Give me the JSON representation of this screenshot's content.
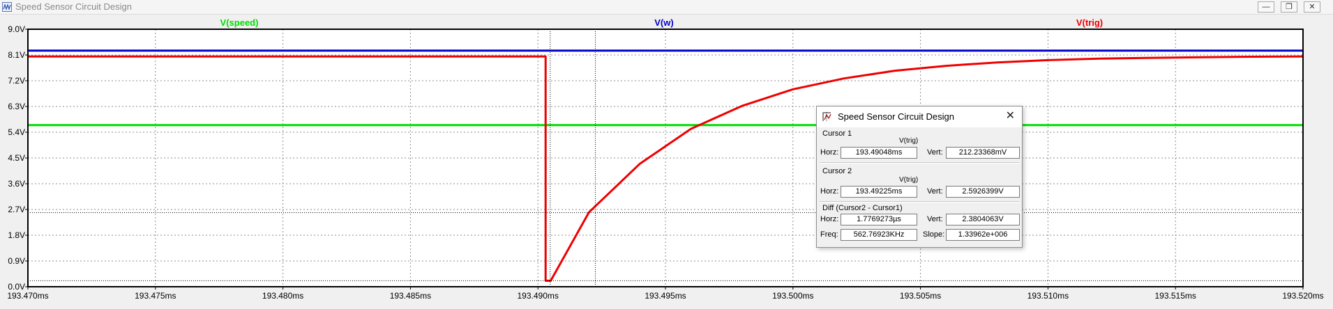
{
  "window": {
    "title": "Speed Sensor Circuit Design",
    "minimize_label": "—",
    "restore_label": "❐",
    "close_label": "✕"
  },
  "colors": {
    "speed": "#00dd00",
    "w": "#0000c8",
    "trig": "#ee0000",
    "grid": "#8c8c8c",
    "axis": "#000000"
  },
  "chart_data": {
    "type": "line",
    "x_unit": "ms",
    "xlim": [
      193.47,
      193.52
    ],
    "ylim": [
      0,
      9.0
    ],
    "x_ticks": [
      193.47,
      193.475,
      193.48,
      193.485,
      193.49,
      193.495,
      193.5,
      193.505,
      193.51,
      193.515,
      193.52
    ],
    "x_tick_labels": [
      "193.470ms",
      "193.475ms",
      "193.480ms",
      "193.485ms",
      "193.490ms",
      "193.495ms",
      "193.500ms",
      "193.505ms",
      "193.510ms",
      "193.515ms",
      "193.520ms"
    ],
    "y_ticks": [
      0,
      0.9,
      1.8,
      2.7,
      3.6,
      4.5,
      5.4,
      6.3,
      7.2,
      8.1,
      9.0
    ],
    "y_tick_labels": [
      "0.0V",
      "0.9V",
      "1.8V",
      "2.7V",
      "3.6V",
      "4.5V",
      "5.4V",
      "6.3V",
      "7.2V",
      "8.1V",
      "9.0V"
    ],
    "grid": true,
    "series": [
      {
        "name": "V(speed)",
        "x": [
          193.47,
          193.52
        ],
        "y": [
          5.65,
          5.65
        ]
      },
      {
        "name": "V(w)",
        "x": [
          193.47,
          193.52
        ],
        "y": [
          8.25,
          8.25
        ]
      },
      {
        "name": "V(trig)",
        "x": [
          193.47,
          193.4903,
          193.4903,
          193.4905,
          193.492,
          193.494,
          193.496,
          193.498,
          193.5,
          193.502,
          193.504,
          193.506,
          193.508,
          193.51,
          193.512,
          193.514,
          193.516,
          193.518,
          193.52
        ],
        "y": [
          8.05,
          8.05,
          0.21,
          0.21,
          2.6,
          4.3,
          5.52,
          6.32,
          6.9,
          7.28,
          7.55,
          7.72,
          7.84,
          7.92,
          7.97,
          8.0,
          8.02,
          8.04,
          8.05
        ]
      }
    ],
    "cursor_lines": {
      "x": [
        193.49048,
        193.49225
      ],
      "y": [
        0.21,
        2.59
      ]
    }
  },
  "cursor_dialog": {
    "title": "Speed Sensor Circuit Design",
    "close_label": "✕",
    "cursor1": {
      "label": "Cursor 1",
      "trace": "V(trig)",
      "horz_label": "Horz:",
      "horz": "193.49048ms",
      "vert_label": "Vert:",
      "vert": "212.23368mV"
    },
    "cursor2": {
      "label": "Cursor 2",
      "trace": "V(trig)",
      "horz_label": "Horz:",
      "horz": "193.49225ms",
      "vert_label": "Vert:",
      "vert": "2.5926399V"
    },
    "diff": {
      "label": "Diff (Cursor2 - Cursor1)",
      "horz_label": "Horz:",
      "horz": "1.7769273µs",
      "vert_label": "Vert:",
      "vert": "2.3804063V",
      "freq_label": "Freq:",
      "freq": "562.76923KHz",
      "slope_label": "Slope:",
      "slope": "1.33962e+006"
    }
  }
}
